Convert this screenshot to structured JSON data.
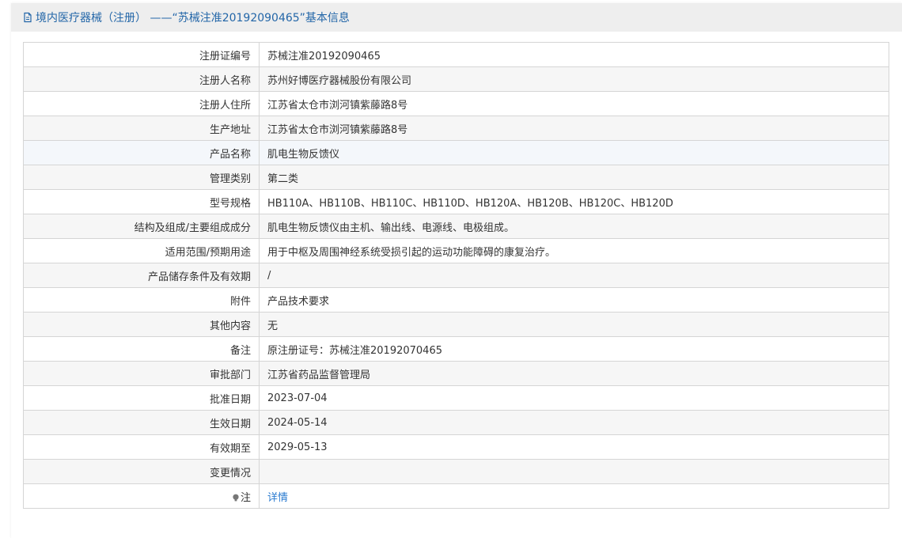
{
  "header": {
    "title": "境内医疗器械（注册） ——“苏械注准20192090465”基本信息"
  },
  "rows": [
    {
      "label": "注册证编号",
      "value": "苏械注准20192090465"
    },
    {
      "label": "注册人名称",
      "value": "苏州好博医疗器械股份有限公司"
    },
    {
      "label": "注册人住所",
      "value": "江苏省太仓市浏河镇紫藤路8号"
    },
    {
      "label": "生产地址",
      "value": "江苏省太仓市浏河镇紫藤路8号"
    },
    {
      "label": "产品名称",
      "value": "肌电生物反馈仪"
    },
    {
      "label": "管理类别",
      "value": "第二类"
    },
    {
      "label": "型号规格",
      "value": "HB110A、HB110B、HB110C、HB110D、HB120A、HB120B、HB120C、HB120D"
    },
    {
      "label": "结构及组成/主要组成成分",
      "value": "肌电生物反馈仪由主机、输出线、电源线、电极组成。"
    },
    {
      "label": "适用范围/预期用途",
      "value": "用于中枢及周围神经系统受损引起的运动功能障碍的康复治疗。"
    },
    {
      "label": "产品储存条件及有效期",
      "value": "/"
    },
    {
      "label": "附件",
      "value": "产品技术要求"
    },
    {
      "label": "其他内容",
      "value": "无"
    },
    {
      "label": "备注",
      "value": "原注册证号：苏械注准20192070465"
    },
    {
      "label": "审批部门",
      "value": "江苏省药品监督管理局"
    },
    {
      "label": "批准日期",
      "value": "2023-07-04"
    },
    {
      "label": "生效日期",
      "value": "2024-05-14"
    },
    {
      "label": "有效期至",
      "value": "2029-05-13"
    },
    {
      "label": "变更情况",
      "value": ""
    }
  ],
  "note_row": {
    "label": "注",
    "link": "详情",
    "icon": "bulb-icon"
  },
  "colors": {
    "accent": "#2366a8",
    "link": "#2a7bd0",
    "header_bg": "#eeeeee",
    "border": "#d5d5d5"
  }
}
